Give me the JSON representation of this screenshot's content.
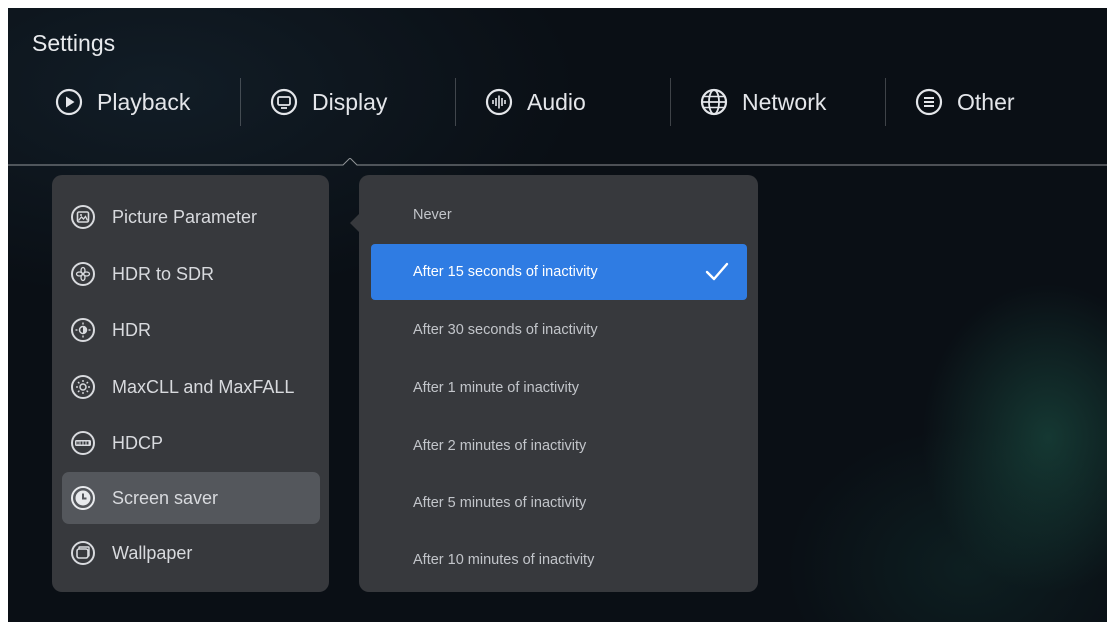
{
  "app": {
    "title": "Settings"
  },
  "tabs": [
    {
      "id": "playback",
      "label": "Playback",
      "icon": "play-circle-icon"
    },
    {
      "id": "display",
      "label": "Display",
      "icon": "monitor-icon",
      "selected": true
    },
    {
      "id": "audio",
      "label": "Audio",
      "icon": "audio-wave-icon"
    },
    {
      "id": "network",
      "label": "Network",
      "icon": "globe-icon"
    },
    {
      "id": "other",
      "label": "Other",
      "icon": "list-icon"
    }
  ],
  "display_menu": [
    {
      "label": "Picture Parameter",
      "icon": "picture-icon"
    },
    {
      "label": "HDR to SDR",
      "icon": "flower-icon"
    },
    {
      "label": "HDR",
      "icon": "hdr-sun-icon"
    },
    {
      "label": "MaxCLL and MaxFALL",
      "icon": "brightness-icon"
    },
    {
      "label": "HDCP",
      "icon": "hdcp-icon"
    },
    {
      "label": "Screen saver",
      "icon": "clock-icon",
      "selected": true
    },
    {
      "label": "Wallpaper",
      "icon": "wallpaper-icon"
    }
  ],
  "screen_saver_options": [
    {
      "label": "Never"
    },
    {
      "label": "After 15 seconds of inactivity",
      "selected": true
    },
    {
      "label": "After 30 seconds of inactivity"
    },
    {
      "label": "After 1 minute of inactivity"
    },
    {
      "label": "After 2 minutes of inactivity"
    },
    {
      "label": "After 5 minutes of inactivity"
    },
    {
      "label": "After 10 minutes of inactivity"
    }
  ],
  "colors": {
    "accent": "#2f7ce3",
    "panel": "#37393d",
    "active_item": "#54575c",
    "background": "#0a0f15",
    "text": "#e4e6ea"
  }
}
